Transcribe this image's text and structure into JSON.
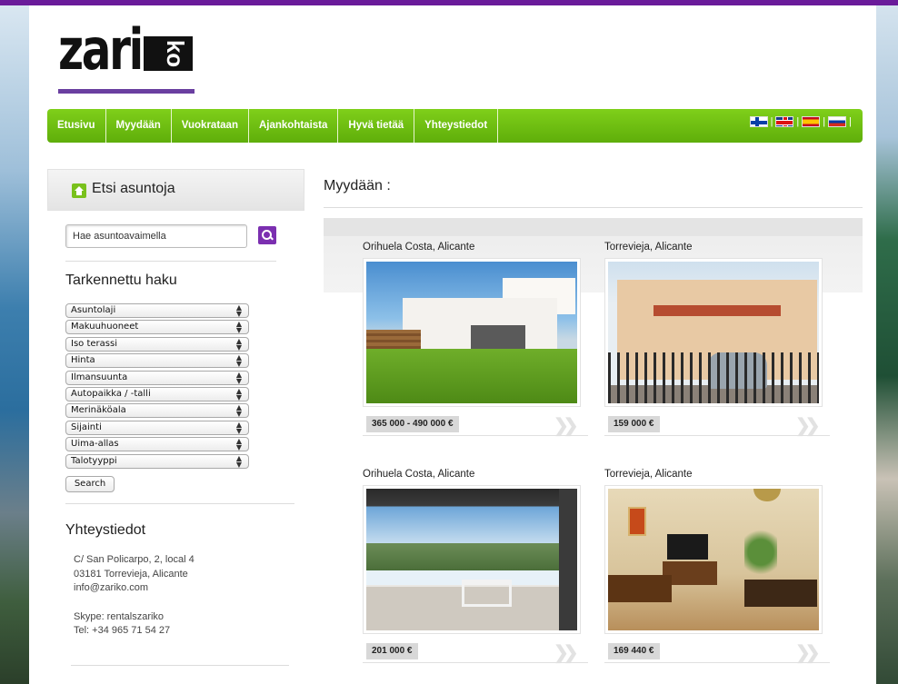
{
  "brand": {
    "logo_main": "zari",
    "logo_rotated": "ko"
  },
  "nav": {
    "items": [
      "Etusivu",
      "Myydään",
      "Vuokrataan",
      "Ajankohtaista",
      "Hyvä tietää",
      "Yhteystiedot"
    ],
    "languages": [
      "fi-flag",
      "gb-flag",
      "es-flag",
      "ru-flag"
    ]
  },
  "sidebar": {
    "title": "Etsi asuntoja",
    "search_placeholder": "Hae asuntoavaimella",
    "advanced_title": "Tarkennettu haku",
    "filters": [
      "Asuntolaji",
      "Makuuhuoneet",
      "Iso terassi",
      "Hinta",
      "Ilmansuunta",
      "Autopaikka / -talli",
      "Merinäköala",
      "Sijainti",
      "Uima-allas",
      "Talotyyppi"
    ],
    "search_button": "Search",
    "contact_title": "Yhteystiedot",
    "contact_lines": [
      "C/ San Policarpo, 2, local 4",
      "03181 Torrevieja, Alicante",
      "info@zariko.com",
      "",
      "Skype: rentalszariko",
      "Tel: +34 965 71 54 27"
    ]
  },
  "main": {
    "title": "Myydään :",
    "listings": [
      {
        "location": "Orihuela Costa, Alicante",
        "price": "365 000 - 490 000 €"
      },
      {
        "location": "Torrevieja, Alicante",
        "price": "159 000 €"
      },
      {
        "location": "Orihuela Costa, Alicante",
        "price": "201 000 €"
      },
      {
        "location": "Torrevieja, Alicante",
        "price": "169 440 €"
      }
    ]
  },
  "colors": {
    "accent": "#6a1b9a",
    "nav_green": "#6fbf12",
    "search_purple": "#7b2fb0",
    "home_green": "#79c11c"
  },
  "icons": {
    "home": "home-icon",
    "search": "search-icon",
    "more": "double-chevron-right-icon"
  }
}
